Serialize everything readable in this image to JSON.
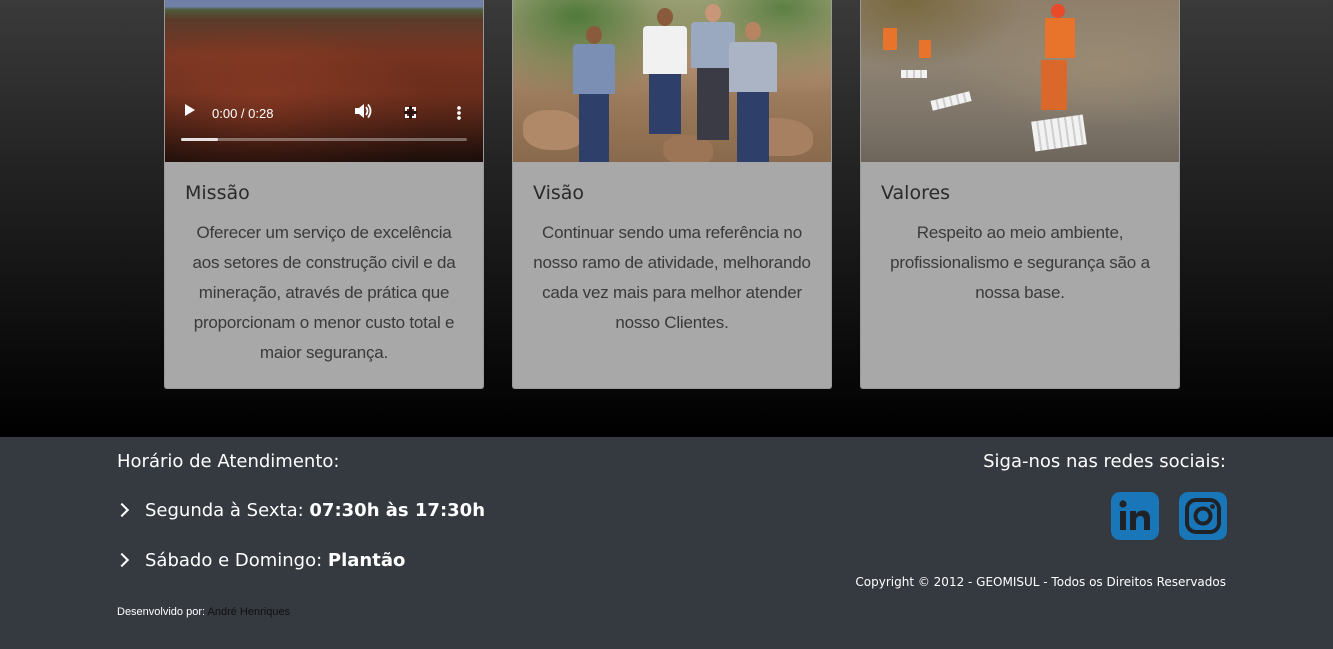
{
  "cards": [
    {
      "title": "Missão",
      "text": "Oferecer um serviço de excelência aos setores de construção civil e da mineração, através de prática que proporcionam o menor custo total e maior segurança.",
      "media": "video",
      "video_time": "0:00 / 0:28"
    },
    {
      "title": "Visão",
      "text": "Continuar sendo uma referência no nosso ramo de atividade, melhorando cada vez mais para melhor atender nosso Clientes.",
      "media": "photo"
    },
    {
      "title": "Valores",
      "text": "Respeito ao meio ambiente, profissionalismo e segurança são a nossa base.",
      "media": "photo"
    }
  ],
  "footer": {
    "hours_title": "Horário de Atendimento:",
    "weekday_label": "Segunda à Sexta:",
    "weekday_value": "07:30h às 17:30h",
    "weekend_label": "Sábado e Domingo:",
    "weekend_value": "Plantão",
    "dev_label": "Desenvolvido por:",
    "dev_name": "André Henriques",
    "social_title": "Siga-nos nas redes sociais:",
    "copyright": "Copyright © 2012 - GEOMISUL - Todos os Direitos Reservados",
    "social": [
      "linkedin-icon",
      "instagram-icon"
    ],
    "social_color": "#1976b8"
  }
}
